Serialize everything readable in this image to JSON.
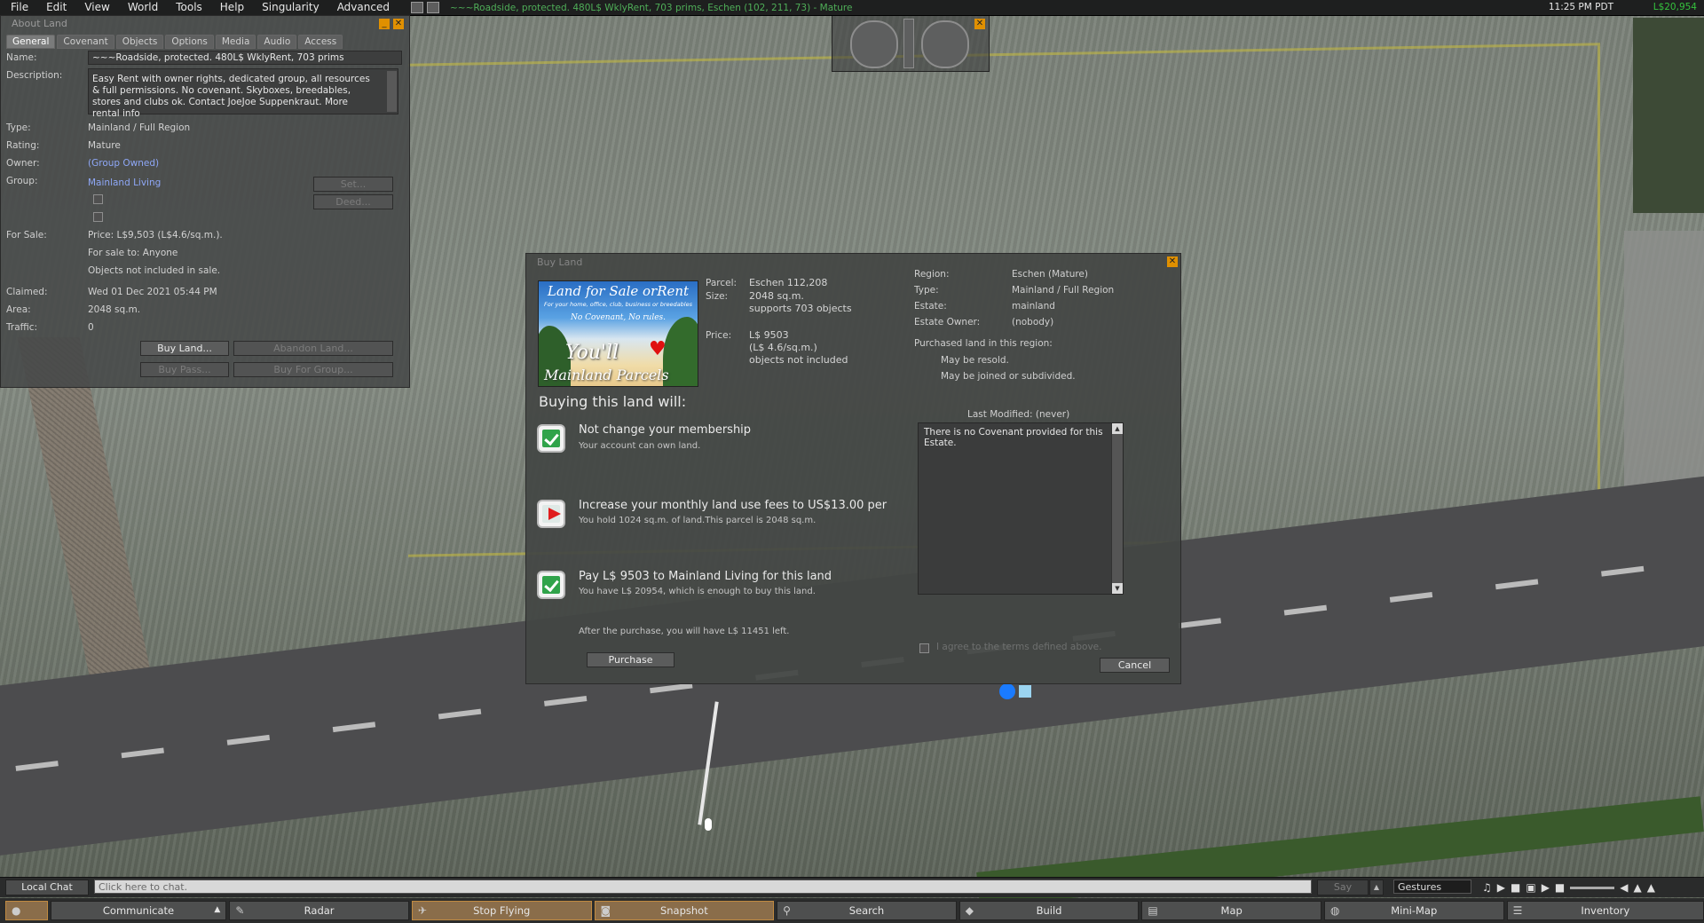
{
  "menubar": {
    "items": [
      "File",
      "Edit",
      "View",
      "World",
      "Tools",
      "Help",
      "Singularity",
      "Advanced"
    ],
    "location": "~~~Roadside, protected. 480L$ WklyRent, 703 prims, Eschen (102, 211, 73) - Mature",
    "clock": "11:25 PM PDT",
    "balance": "L$20,954"
  },
  "about_land": {
    "title": "About Land",
    "tabs": [
      "General",
      "Covenant",
      "Objects",
      "Options",
      "Media",
      "Audio",
      "Access"
    ],
    "name_label": "Name:",
    "name_value": "~~~Roadside, protected. 480L$ WklyRent, 703 prims",
    "description_label": "Description:",
    "description_value": "Easy Rent with owner rights, dedicated group, all resources & full permissions. No covenant. Skyboxes, breedables, stores and clubs ok. Contact JoeJoe Suppenkraut. More rental info",
    "type_label": "Type:",
    "type_value": "Mainland / Full Region",
    "rating_label": "Rating:",
    "rating_value": "Mature",
    "owner_label": "Owner:",
    "owner_value": "(Group Owned)",
    "group_label": "Group:",
    "group_value": "Mainland Living",
    "set_button": "Set...",
    "deed_button": "Deed...",
    "for_sale_label": "For Sale:",
    "price_text": "Price: L$9,503 (L$4.6/sq.m.).",
    "sale_to_text": "For sale to: Anyone",
    "objects_text": "Objects not included in sale.",
    "claimed_label": "Claimed:",
    "claimed_value": "Wed 01 Dec 2021 05:44 PM",
    "area_label": "Area:",
    "area_value": "2048 sq.m.",
    "traffic_label": "Traffic:",
    "traffic_value": "0",
    "buy_land_button": "Buy Land...",
    "abandon_button": "Abandon Land...",
    "buy_pass_button": "Buy Pass...",
    "buy_for_group_button": "Buy For Group..."
  },
  "buy_land": {
    "title": "Buy Land",
    "ad": {
      "line1": "Land for Sale orRent",
      "line2": "For your home, office, club, business or breedables",
      "line3": "No Covenant, No rules.",
      "line4": "You'll",
      "line5": "Mainland Parcels"
    },
    "parcel_label": "Parcel:",
    "parcel_value": "Eschen 112,208",
    "size_label": "Size:",
    "size_value": "2048 sq.m.",
    "size_sub": "supports 703 objects",
    "price_label": "Price:",
    "price_value": "L$ 9503",
    "price_sub1": "(L$ 4.6/sq.m.)",
    "price_sub2": "objects not included",
    "region_label": "Region:",
    "region_value": "Eschen (Mature)",
    "type_label": "Type:",
    "type_value": "Mainland / Full Region",
    "estate_label": "Estate:",
    "estate_value": "mainland",
    "estate_owner_label": "Estate Owner:",
    "estate_owner_value": "(nobody)",
    "purchased_heading": "Purchased land in this region:",
    "resold": "May be resold.",
    "joined": "May be joined or subdivided.",
    "buying_heading": "Buying this land will:",
    "step1_title": "Not change your membership",
    "step1_sub": "Your account can own land.",
    "step2_title": "Increase your monthly land use fees to US$13.00 per",
    "step2_sub": "You hold 1024 sq.m. of land.This parcel is 2048 sq.m.",
    "step3_title": "Pay L$ 9503 to Mainland Living for this land",
    "step3_sub": "You have L$ 20954, which is enough to buy this land.",
    "after_text": "After the purchase, you will have L$ 11451 left.",
    "purchase_button": "Purchase",
    "last_modified": "Last Modified: (never)",
    "covenant_text": "There is no Covenant provided for this Estate.",
    "agree_text": "I agree to the terms defined above.",
    "cancel_button": "Cancel"
  },
  "chatbar": {
    "local_chat": "Local Chat",
    "chat_placeholder": "Click here to chat.",
    "say": "Say",
    "gestures": "Gestures"
  },
  "toolbar": {
    "communicate": "Communicate",
    "radar": "Radar",
    "stop_flying": "Stop Flying",
    "snapshot": "Snapshot",
    "search": "Search",
    "build": "Build",
    "map": "Map",
    "minimap": "Mini-Map",
    "inventory": "Inventory"
  },
  "colors": {
    "accent_orange": "#e09000",
    "link_blue": "#8ea7f6",
    "location_green": "#4fae58",
    "balance_green": "#35c13d"
  }
}
